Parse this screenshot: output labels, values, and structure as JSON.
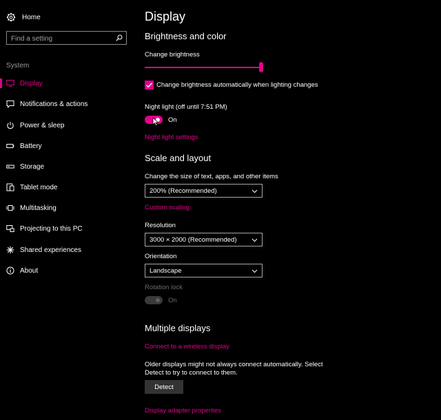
{
  "sidebar": {
    "home_label": "Home",
    "search_placeholder": "Find a setting",
    "section_label": "System",
    "items": [
      {
        "label": "Display",
        "icon": "monitor-icon",
        "active": true
      },
      {
        "label": "Notifications & actions",
        "icon": "message-icon"
      },
      {
        "label": "Power & sleep",
        "icon": "power-icon"
      },
      {
        "label": "Battery",
        "icon": "battery-icon"
      },
      {
        "label": "Storage",
        "icon": "storage-icon"
      },
      {
        "label": "Tablet mode",
        "icon": "tablet-icon"
      },
      {
        "label": "Multitasking",
        "icon": "multitasking-icon"
      },
      {
        "label": "Projecting to this PC",
        "icon": "projecting-icon"
      },
      {
        "label": "Shared experiences",
        "icon": "shared-icon"
      },
      {
        "label": "About",
        "icon": "info-icon"
      }
    ]
  },
  "main": {
    "title": "Display",
    "brightness": {
      "heading": "Brightness and color",
      "slider_label": "Change brightness",
      "level_percent": 100,
      "auto_checkbox_label": "Change brightness automatically when lighting changes",
      "auto_checked": true,
      "night_light_label": "Night light (off until 7:51 PM)",
      "night_light_state": "On",
      "night_light_link": "Night light settings"
    },
    "scale": {
      "heading": "Scale and layout",
      "size_label": "Change the size of text, apps, and other items",
      "size_value": "200% (Recommended)",
      "custom_link": "Custom scaling",
      "resolution_label": "Resolution",
      "resolution_value": "3000 × 2000 (Recommended)",
      "orientation_label": "Orientation",
      "orientation_value": "Landscape",
      "rotation_label": "Rotation lock",
      "rotation_state": "On"
    },
    "multiple": {
      "heading": "Multiple displays",
      "wireless_link": "Connect to a wireless display",
      "info_line1": "Older displays might not always connect automatically. Select",
      "info_line2": "Detect to try to connect to them.",
      "detect_button": "Detect",
      "adapter_link": "Display adapter properties"
    }
  },
  "colors": {
    "accent": "#e3008c",
    "background": "#000000"
  }
}
